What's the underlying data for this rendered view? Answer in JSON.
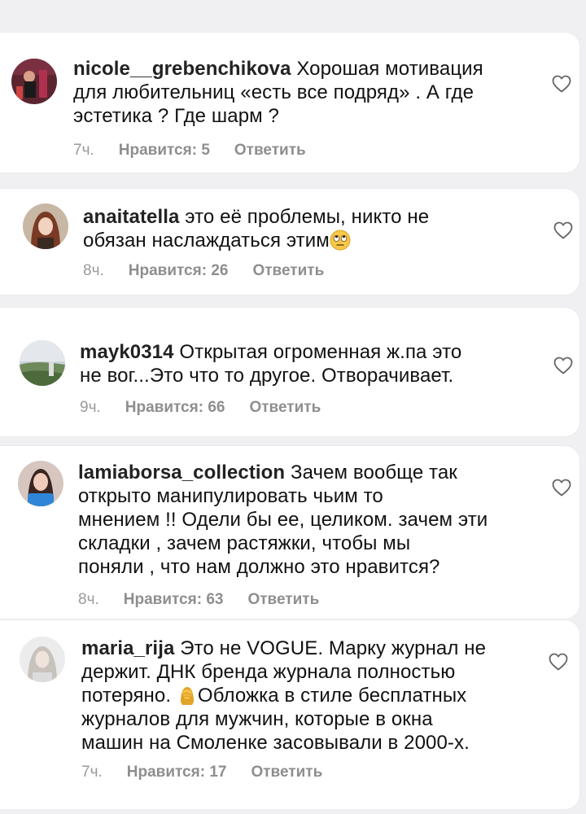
{
  "comments": [
    {
      "username": "nicole__grebenchikova",
      "text": "Хорошая мотивация для любительниц «есть все подряд» . А где эстетика ? Где шарм ?",
      "line1": "Хорошая мотивация",
      "line2": "для любительниц «есть все подряд» . А где",
      "line3": "эстетика ? Где шарм ?",
      "time": "7ч.",
      "likes": "Нравится: 5",
      "reply": "Ответить"
    },
    {
      "username": "anaitatella",
      "line1": "это её проблемы, никто не",
      "line2": "обязан наслаждаться этим",
      "emoji": "eye-roll-emoji",
      "time": "8ч.",
      "likes": "Нравится: 26",
      "reply": "Ответить"
    },
    {
      "username": "mayk0314",
      "line1": "Открытая огроменная ж.па  это",
      "line2": "не вог...Это что то другое. Отворачивает.",
      "time": "9ч.",
      "likes": "Нравится: 66",
      "reply": "Ответить"
    },
    {
      "username": "lamiaborsa_collection",
      "line1": "Зачем вообще так",
      "line2": "открыто манипулировать чьим то",
      "line3": "мнением !! Одели бы ее, целиком. зачем эти",
      "line4": "складки , зачем растяжки, чтобы мы",
      "line5": "поняли , что нам должно это нравится?",
      "time": "8ч.",
      "likes": "Нравится: 63",
      "reply": "Ответить"
    },
    {
      "username": "maria_rija",
      "line1": "Это не VOGUE. Марку журнал не",
      "line2": "держит. ДНК бренда журнала полностью",
      "line3a": "потеряно.",
      "emoji": "facepalm-emoji",
      "line3b": "Обложка в стиле бесплатных",
      "line4": "журналов для мужчин, которые в окна",
      "line5": "машин на Смоленке засовывали  в 2000-х.",
      "time": "7ч.",
      "likes": "Нравится: 17",
      "reply": "Ответить"
    }
  ],
  "icons": {
    "like": "heart-outline-icon"
  },
  "colors": {
    "background": "#f0f0f2",
    "card": "#ffffff",
    "meta_text": "#8e8e8e",
    "text": "#111111"
  }
}
